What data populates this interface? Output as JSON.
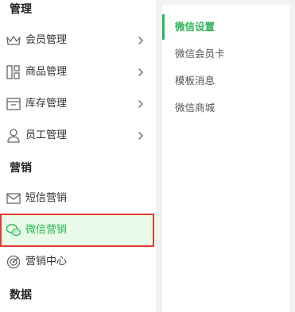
{
  "sidebar": {
    "sections": {
      "manage": "管理",
      "marketing": "营销",
      "data": "数据"
    },
    "items": [
      {
        "label": "会员管理",
        "icon": "crown-icon"
      },
      {
        "label": "商品管理",
        "icon": "product-grid-icon"
      },
      {
        "label": "库存管理",
        "icon": "inventory-box-icon"
      },
      {
        "label": "员工管理",
        "icon": "user-icon"
      },
      {
        "label": "短信营销",
        "icon": "mail-icon"
      },
      {
        "label": "微信营销",
        "icon": "wechat-icon"
      },
      {
        "label": "营销中心",
        "icon": "target-icon"
      }
    ],
    "active_item": "微信营销"
  },
  "subpanel": {
    "items": [
      {
        "label": "微信设置"
      },
      {
        "label": "微信会员卡"
      },
      {
        "label": "模板消息"
      },
      {
        "label": "微信商城"
      }
    ],
    "active_item": "微信设置"
  },
  "colors": {
    "accent": "#2eb354",
    "active_bg": "#e8fbe9",
    "highlight_border": "#e53935",
    "panel_bg": "#f2f2f2"
  }
}
